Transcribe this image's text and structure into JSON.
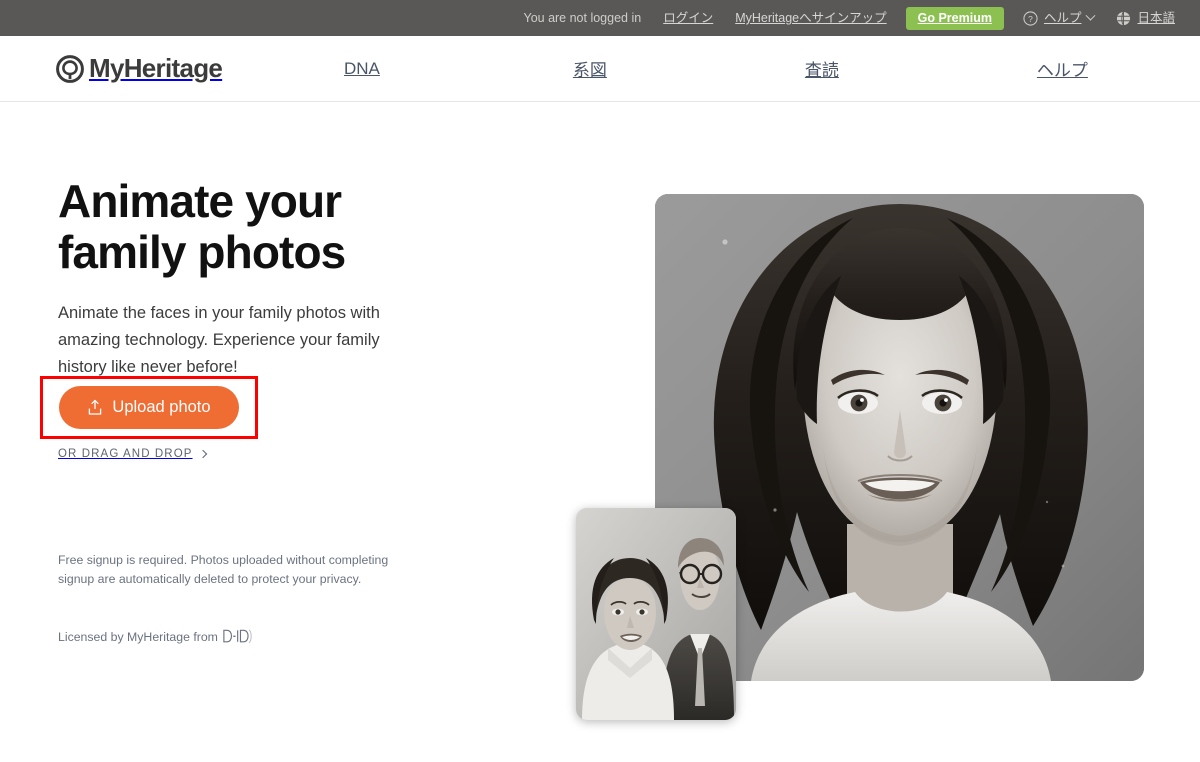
{
  "topbar": {
    "status_text": "You are not logged in",
    "login_label": "ログイン",
    "signup_label": "MyHeritageへサインアップ",
    "premium_label": "Go Premium",
    "help_label": "ヘルプ",
    "language_label": "日本語",
    "help_icon": "question-circle-icon",
    "globe_icon": "globe-icon",
    "chevron_icon": "chevron-down-icon",
    "background_color": "#595857",
    "premium_color": "#8cc152"
  },
  "nav": {
    "brand": "MyHeritage",
    "brand_icon": "myheritage-logo-icon",
    "links": [
      {
        "label": "DNA"
      },
      {
        "label": "系図"
      },
      {
        "label": "査読"
      },
      {
        "label": "ヘルプ"
      }
    ]
  },
  "hero": {
    "title": "Animate your\nfamily photos",
    "subtitle": "Animate the faces in your family photos with amazing technology. Experience your family history like never before!",
    "upload_button_label": "Upload photo",
    "upload_icon": "upload-icon",
    "drag_drop_label": "OR DRAG AND DROP",
    "drag_chevron_icon": "chevron-right-icon",
    "legal_text": "Free signup is required. Photos uploaded without completing signup are automatically deleted to protect your privacy.",
    "licensed_text": "Licensed by MyHeritage from",
    "licensed_logo": "d-id-logo-icon",
    "accent_color": "#ef6c33",
    "highlight_color": "#fd0000"
  },
  "photos": {
    "main": {
      "name": "animated-portrait-woman",
      "description": "Black and white vintage portrait of a smiling young woman with dark bouffant hair"
    },
    "inset": {
      "name": "family-photo-couple",
      "description": "Black and white vintage portrait of a young couple, woman in white top and man in suit with glasses"
    }
  }
}
